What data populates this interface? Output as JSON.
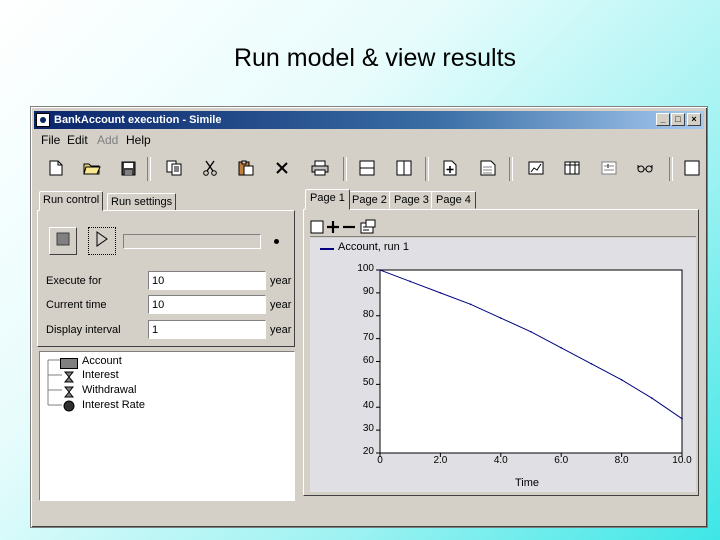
{
  "slide": {
    "title": "Run model & view results"
  },
  "window": {
    "title": "BankAccount  execution - Simile",
    "controls": {
      "minimize": "_",
      "maximize": "□",
      "close": "×"
    }
  },
  "menu": [
    {
      "label": "File",
      "enabled": true
    },
    {
      "label": "Edit",
      "enabled": true
    },
    {
      "label": "Add",
      "enabled": false
    },
    {
      "label": "Help",
      "enabled": true
    }
  ],
  "toolbar_icons": [
    "new-file-icon",
    "open-folder-icon",
    "save-icon",
    "copy-icon",
    "cut-icon",
    "paste-icon",
    "delete-icon",
    "print-icon",
    "split-horizontal-icon",
    "split-vertical-icon",
    "add-page-icon",
    "page-settings-icon",
    "plot-icon",
    "table-icon",
    "slider-icon",
    "glasses-icon",
    "window-icon"
  ],
  "run_panel": {
    "tabs": [
      "Run control",
      "Run settings"
    ],
    "active_tab": 0,
    "buttons": [
      "stop-icon",
      "play-icon"
    ],
    "fields": [
      {
        "label": "Execute for",
        "value": "10",
        "unit": "year"
      },
      {
        "label": "Current time",
        "value": "10",
        "unit": "year"
      },
      {
        "label": "Display interval",
        "value": "1",
        "unit": "year"
      }
    ]
  },
  "model_tree": [
    {
      "label": "Account",
      "icon": "compartment-icon"
    },
    {
      "label": "Interest",
      "icon": "flow-icon"
    },
    {
      "label": "Withdrawal",
      "icon": "flow-icon"
    },
    {
      "label": "Interest Rate",
      "icon": "variable-icon"
    }
  ],
  "pages": {
    "tabs": [
      "Page 1",
      "Page 2",
      "Page 3",
      "Page 4"
    ],
    "active": 0
  },
  "chart_data": {
    "type": "line",
    "title": "",
    "xlabel": "Time",
    "ylabel": "",
    "xlim": [
      0,
      10
    ],
    "ylim": [
      20,
      100
    ],
    "x_ticks": [
      "0",
      "2.0",
      "4.0",
      "6.0",
      "8.0",
      "10.0"
    ],
    "y_ticks": [
      "100",
      "90",
      "80",
      "70",
      "60",
      "50",
      "40",
      "30",
      "20"
    ],
    "series": [
      {
        "name": "Account, run 1",
        "color": "#000080",
        "x": [
          0,
          1,
          2,
          3,
          4,
          5,
          6,
          7,
          8,
          9,
          10
        ],
        "y": [
          100,
          95,
          90,
          85,
          79,
          73,
          66,
          59,
          52,
          44,
          35
        ]
      }
    ]
  }
}
